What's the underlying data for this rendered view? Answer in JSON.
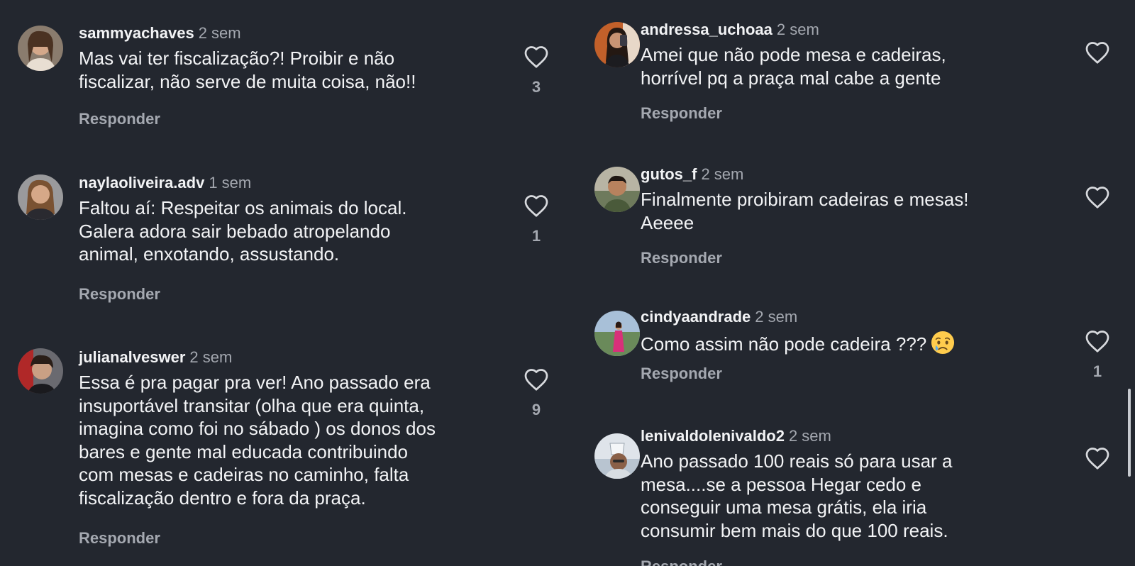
{
  "comments_left": [
    {
      "username": "sammyachaves",
      "time": "2 sem",
      "text": "Mas vai ter fiscalização?! Proibir e não\nfiscalizar, não serve de muita coisa, não!!",
      "likes": "3",
      "reply": "Responder"
    },
    {
      "username": "naylaoliveira.adv",
      "time": "1 sem",
      "text": "Faltou aí: Respeitar os animais do local.\nGalera adora sair bebado atropelando\nanimal, enxotando, assustando.",
      "likes": "1",
      "reply": "Responder"
    },
    {
      "username": "julianalveswer",
      "time": "2 sem",
      "text": "Essa é pra pagar pra ver! Ano passado era\ninsuportável transitar (olha que era quinta,\nimagina como foi no sábado ) os donos dos\nbares e gente mal educada contribuindo\ncom mesas e cadeiras no caminho, falta\nfiscalização dentro e fora da praça.",
      "likes": "9",
      "reply": "Responder"
    }
  ],
  "comments_right": [
    {
      "username": "andressa_uchoaa",
      "time": "2 sem",
      "text": "Amei que não pode mesa e cadeiras,\nhorrível pq a praça mal cabe a gente",
      "likes": "",
      "reply": "Responder"
    },
    {
      "username": "gutos_f",
      "time": "2 sem",
      "text": "Finalmente proibiram cadeiras e mesas!\nAeeee",
      "likes": "",
      "reply": "Responder"
    },
    {
      "username": "cindyaandrade",
      "time": "2 sem",
      "text": "Como assim não pode cadeira ???",
      "emoji": "crying-face-emoji",
      "likes": "1",
      "reply": "Responder"
    },
    {
      "username": "lenivaldolenivaldo2",
      "time": "2 sem",
      "text": "Ano passado 100 reais só para usar a\nmesa....se a pessoa  Hegar cedo e\nconseguir uma mesa grátis, ela iria\nconsumir bem mais do que 100 reais.",
      "likes": "",
      "reply": "Responder"
    }
  ],
  "icons": {
    "like": "heart-outline-icon"
  },
  "colors": {
    "background": "#23272f",
    "text": "#f2f3f5",
    "muted": "#a4a8b0"
  }
}
